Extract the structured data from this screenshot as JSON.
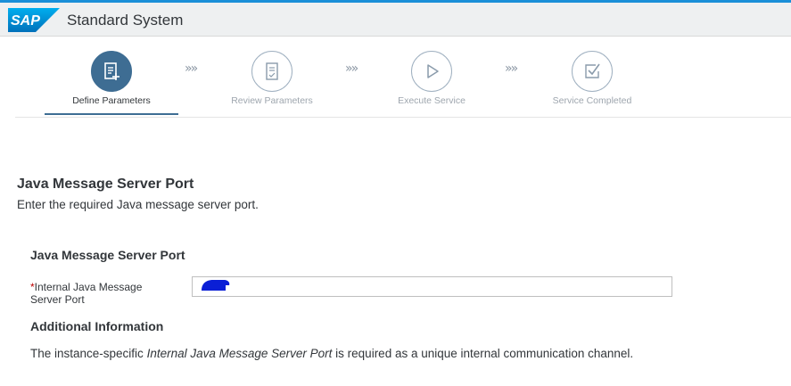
{
  "shell": {
    "logo_text": "SAP",
    "title": "Standard System"
  },
  "wizard": {
    "steps": [
      {
        "label": "Define Parameters",
        "icon": "document-edit-icon",
        "active": true
      },
      {
        "label": "Review Parameters",
        "icon": "document-review-icon",
        "active": false
      },
      {
        "label": "Execute Service",
        "icon": "play-icon",
        "active": false
      },
      {
        "label": "Service Completed",
        "icon": "checkbox-check-icon",
        "active": false
      }
    ],
    "separator": "»»"
  },
  "section": {
    "title": "Java Message Server Port",
    "description": "Enter the required Java message server port."
  },
  "form": {
    "title": "Java Message Server Port",
    "field": {
      "required_marker": "*",
      "label": "Internal Java Message Server Port",
      "value": ""
    },
    "additional": {
      "title": "Additional Information",
      "text_before": "The instance-specific ",
      "text_emphasis": "Internal Java Message Server Port",
      "text_after": " is required as a unique internal communication channel."
    }
  },
  "colors": {
    "accent": "#3e6d93",
    "topline": "#1a8fd8",
    "required": "#bb0000",
    "redaction": "#0a1fd6"
  }
}
